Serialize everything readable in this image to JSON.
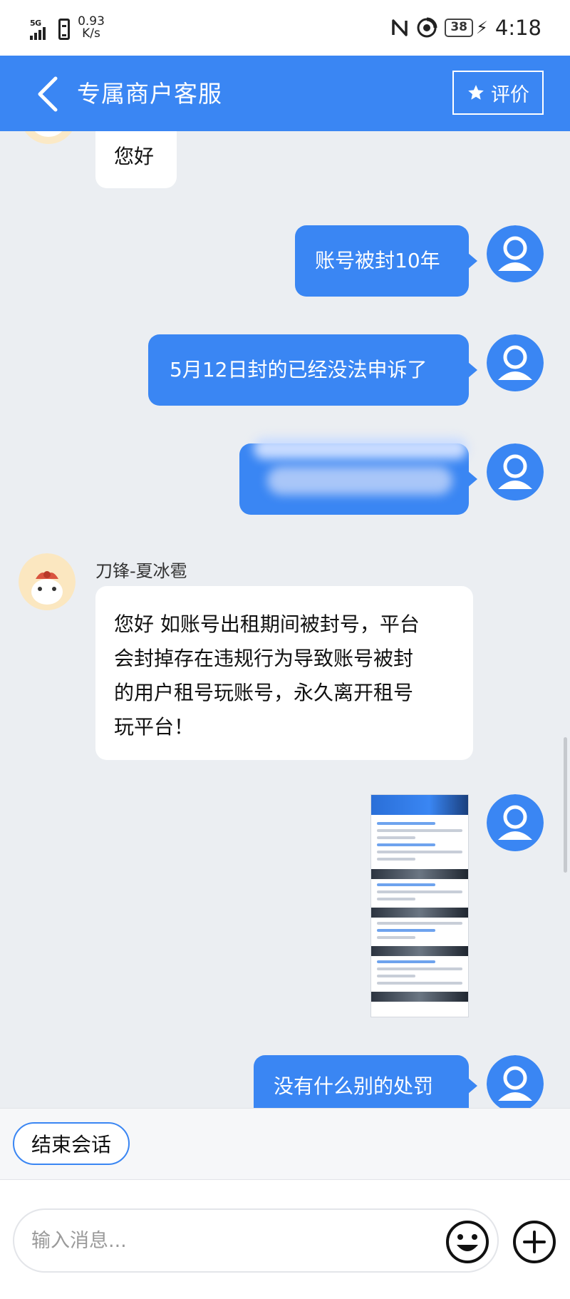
{
  "status_bar": {
    "signal": "5G",
    "net_speed_value": "0.93",
    "net_speed_unit": "K/s",
    "battery": "38",
    "time": "4:18"
  },
  "nav": {
    "title": "专属商户客服",
    "rate_label": "评价",
    "accent_color": "#3a86f3"
  },
  "messages": [
    {
      "from": "agent",
      "text": "您好"
    },
    {
      "from": "user",
      "text": "账号被封10年"
    },
    {
      "from": "user",
      "text": "5月12日封的已经没法申诉了"
    },
    {
      "from": "user",
      "text": "",
      "blurred": true
    },
    {
      "from": "agent",
      "sender": "刀锋-夏冰雹",
      "lines": [
        "您好 如账号出租期间被封号，平台",
        "会封掉存在违规行为导致账号被封",
        "的用户租号玩账号，永久离开租号",
        "玩平台！"
      ]
    },
    {
      "from": "user",
      "type": "image"
    },
    {
      "from": "user",
      "text": "没有什么别的处罚"
    }
  ],
  "quick_reply": {
    "end_chat": "结束会话"
  },
  "input": {
    "placeholder": "输入消息..."
  }
}
